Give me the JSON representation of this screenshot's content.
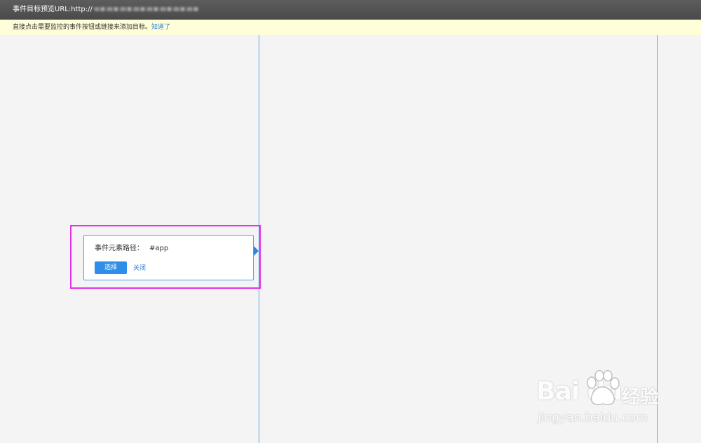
{
  "topbar": {
    "url_label": "事件目标预览URL:http://"
  },
  "hintbar": {
    "message": "直接点击需要监控的事件按钮或链接来添加目标。",
    "link_text": "知道了"
  },
  "popup": {
    "path_label": "事件元素路径：",
    "path_value": "#app",
    "select_label": "选择",
    "close_label": "关闭"
  },
  "watermark": {
    "brand_latin": "Bai du",
    "brand_cn": "经验",
    "url": "jingyan.baidu.com"
  },
  "colors": {
    "accent": "#2f8ee8",
    "highlight": "#e432e8",
    "guide": "#57a7e8",
    "hint_bg": "#fefed9",
    "topbar_bg": "#4f4f4f"
  }
}
